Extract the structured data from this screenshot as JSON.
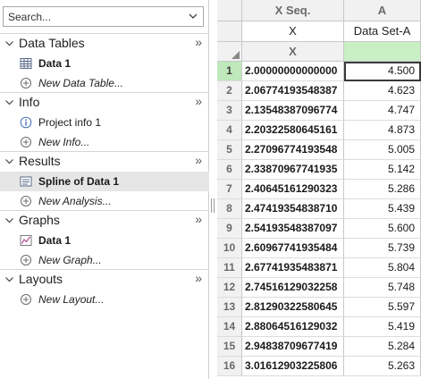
{
  "search": {
    "placeholder": "Search..."
  },
  "sections": [
    {
      "title": "Data Tables",
      "items": [
        {
          "label": "Data 1",
          "icon": "table-icon",
          "style": "bold"
        },
        {
          "label": "New Data Table...",
          "icon": "plus-circle-icon",
          "style": "italic"
        }
      ]
    },
    {
      "title": "Info",
      "items": [
        {
          "label": "Project info 1",
          "icon": "info-icon",
          "style": "normal"
        },
        {
          "label": "New Info...",
          "icon": "plus-circle-icon",
          "style": "italic"
        }
      ]
    },
    {
      "title": "Results",
      "items": [
        {
          "label": "Spline of Data 1",
          "icon": "results-icon",
          "style": "bold",
          "selected": true
        },
        {
          "label": "New Analysis...",
          "icon": "plus-circle-icon",
          "style": "italic"
        }
      ]
    },
    {
      "title": "Graphs",
      "items": [
        {
          "label": "Data 1",
          "icon": "graph-icon",
          "style": "bold"
        },
        {
          "label": "New Graph...",
          "icon": "plus-circle-icon",
          "style": "italic"
        }
      ]
    },
    {
      "title": "Layouts",
      "items": [
        {
          "label": "New Layout...",
          "icon": "plus-circle-icon",
          "style": "italic"
        }
      ]
    }
  ],
  "section_more": "»",
  "grid": {
    "col_x_header": "X Seq.",
    "col_a_header": "A",
    "col_x_title": "X",
    "col_a_title": "Data Set-A",
    "col_x_sub": "X",
    "col_a_sub": "",
    "rows": [
      {
        "n": "1",
        "x": "2.00000000000000",
        "a": "4.500"
      },
      {
        "n": "2",
        "x": "2.06774193548387",
        "a": "4.623"
      },
      {
        "n": "3",
        "x": "2.13548387096774",
        "a": "4.747"
      },
      {
        "n": "4",
        "x": "2.20322580645161",
        "a": "4.873"
      },
      {
        "n": "5",
        "x": "2.27096774193548",
        "a": "5.005"
      },
      {
        "n": "6",
        "x": "2.33870967741935",
        "a": "5.142"
      },
      {
        "n": "7",
        "x": "2.40645161290323",
        "a": "5.286"
      },
      {
        "n": "8",
        "x": "2.47419354838710",
        "a": "5.439"
      },
      {
        "n": "9",
        "x": "2.54193548387097",
        "a": "5.600"
      },
      {
        "n": "10",
        "x": "2.60967741935484",
        "a": "5.739"
      },
      {
        "n": "11",
        "x": "2.67741935483871",
        "a": "5.804"
      },
      {
        "n": "12",
        "x": "2.74516129032258",
        "a": "5.748"
      },
      {
        "n": "13",
        "x": "2.81290322580645",
        "a": "5.597"
      },
      {
        "n": "14",
        "x": "2.88064516129032",
        "a": "5.419"
      },
      {
        "n": "15",
        "x": "2.94838709677419",
        "a": "5.284"
      },
      {
        "n": "16",
        "x": "3.01612903225806",
        "a": "5.263"
      }
    ]
  }
}
